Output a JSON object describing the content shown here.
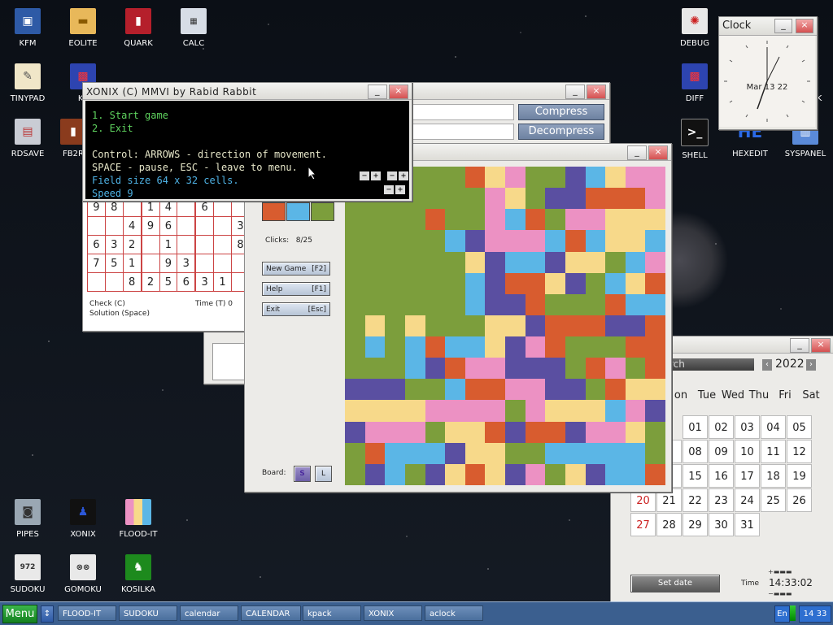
{
  "desktop_icons": [
    {
      "label": "KFM"
    },
    {
      "label": "EOLITE"
    },
    {
      "label": "QUARK"
    },
    {
      "label": "CALC"
    },
    {
      "label": "TINYPAD"
    },
    {
      "label": "KF"
    },
    {
      "label": "RDSAVE"
    },
    {
      "label": "FB2R"
    },
    {
      "label": "PIPES"
    },
    {
      "label": "XONIX"
    },
    {
      "label": "FLOOD-IT"
    },
    {
      "label": "SUDOKU"
    },
    {
      "label": "GOMOKU"
    },
    {
      "label": "KOSILKA"
    },
    {
      "label": "DEBUG"
    },
    {
      "label": "DIFF"
    },
    {
      "label": "SHELL"
    },
    {
      "label": "HEXEDIT"
    },
    {
      "label": "SYSPANEL"
    },
    {
      "label": "K"
    }
  ],
  "clock_window": {
    "title": "Clock",
    "date": "Mar 13 22"
  },
  "kpack_window": {
    "compress_label": "Compress",
    "decompress_label": "Decompress"
  },
  "xonix": {
    "title": "XONIX (C) MMVI by Rabid Rabbit",
    "lines": [
      "1. Start game",
      "2. Exit",
      "",
      "Control: ARROWS - direction of movement.",
      "SPACE - pause, ESC - leave to menu."
    ],
    "field": "Field size 64 x 32 cells.",
    "speed": "Speed 9",
    "minus": "−",
    "plus": "+"
  },
  "sudoku": {
    "rows": [
      [
        "9",
        "8",
        "",
        "1",
        "4",
        "",
        "6",
        "",
        ""
      ],
      [
        "",
        "",
        "4",
        "9",
        "6",
        "",
        "",
        "",
        "3"
      ],
      [
        "6",
        "3",
        "2",
        "",
        "1",
        "",
        "",
        "",
        "8"
      ],
      [
        "7",
        "5",
        "1",
        "",
        "9",
        "3",
        "",
        "",
        ""
      ],
      [
        "",
        "",
        "8",
        "2",
        "5",
        "6",
        "3",
        "1",
        ""
      ]
    ],
    "check": "Check (C)",
    "time": "Time (T) 0",
    "solution": "Solution (Space)"
  },
  "flood": {
    "clicks_label": "Clicks:",
    "clicks_value": "8/25",
    "new_game": "New Game",
    "new_game_key": "[F2]",
    "help": "Help",
    "help_key": "[F1]",
    "exit": "Exit",
    "exit_key": "[Esc]",
    "board_label": "Board:",
    "board_s": "S",
    "board_l": "L",
    "palette": [
      "#d85c2f",
      "#5bb6e6",
      "#7c9e3c"
    ],
    "colors": {
      "g": "#7c9e3c",
      "o": "#d85c2f",
      "y": "#f7d98a",
      "p": "#ec91c3",
      "b": "#5bb6e6",
      "v": "#5a4fa1"
    },
    "grid": [
      "ggggggoypggvbypp",
      "gggggggpygvvooop",
      "ggggoggpbogppyyy",
      "gggggbvpppbobyyb",
      "ggggggyvbbvyygbp",
      "ggggggbvooyvgbyo",
      "ggggggbvvogggobb",
      "gygygggyyvooovvo",
      "gbgbobbyvpogggoo",
      "gggbvoppvvvgopgo",
      "vvvggbooppvvgoyy",
      "yyyyppppgpyyybpv",
      "vpppgyyovoovppyg",
      "gobbbvyyggbbbbbg",
      "gvbgvyoyvpgyvbbo"
    ]
  },
  "calendar": {
    "search": "rch",
    "year": "2022",
    "weekdays": [
      "on",
      "Tue",
      "Wed",
      "Thu",
      "Fri",
      "Sat"
    ],
    "weeks": [
      [
        "",
        "01",
        "02",
        "03",
        "04",
        "05"
      ],
      [
        "7",
        "08",
        "09",
        "10",
        "11",
        "12"
      ],
      [
        "4",
        "15",
        "16",
        "17",
        "18",
        "19"
      ],
      [
        "20",
        "21",
        "22",
        "23",
        "24",
        "25",
        "26"
      ],
      [
        "27",
        "28",
        "29",
        "30",
        "31"
      ]
    ],
    "set_date": "Set date",
    "time_label": "Time",
    "time_value": "14:33:02"
  },
  "taskbar": {
    "menu": "Menu",
    "tasks": [
      "FLOOD-IT",
      "SUDOKU",
      "calendar",
      "CALENDAR",
      "kpack",
      "XONIX",
      "aclock"
    ],
    "lang": "En",
    "clock": "14 33"
  }
}
